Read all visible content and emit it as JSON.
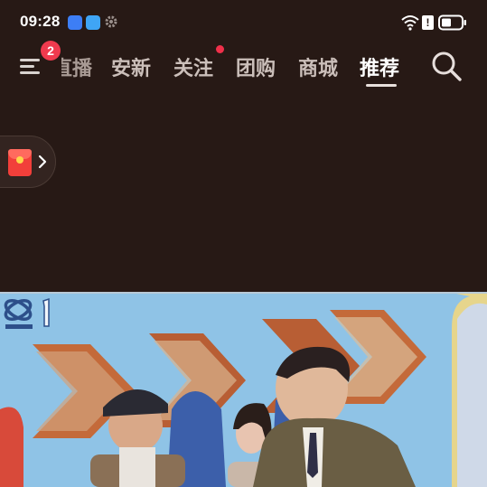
{
  "status_bar": {
    "time": "09:28",
    "icons": [
      "message-app-icon",
      "weather-app-icon",
      "settings-gear-icon",
      "wifi-icon",
      "alert-icon",
      "battery-icon"
    ],
    "alert_symbol": "!"
  },
  "nav": {
    "menu_badge_count": "2",
    "tabs": [
      {
        "label": "直播",
        "state": "partially-visible"
      },
      {
        "label": "安新",
        "state": "normal"
      },
      {
        "label": "关注",
        "state": "has-red-dot"
      },
      {
        "label": "团购",
        "state": "normal"
      },
      {
        "label": "商城",
        "state": "normal"
      },
      {
        "label": "推荐",
        "state": "active"
      }
    ]
  },
  "floating": {
    "icon": "red-envelope-icon",
    "arrow": "chevron-right-icon"
  },
  "video": {
    "content": "tv-broadcast-frame",
    "channel_logo": "channel-1-logo-icon"
  },
  "colors": {
    "background": "#271915",
    "badge": "#f03a4e",
    "active_tab": "#ffffff",
    "inactive_tab": "#cbbfba",
    "red_packet": "#f23f3a"
  }
}
